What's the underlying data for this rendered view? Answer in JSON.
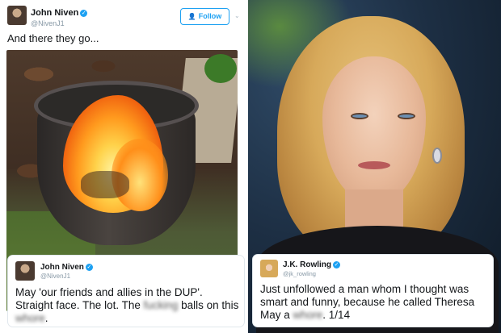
{
  "left_tweet": {
    "author_name": "John Niven",
    "author_handle": "@NivenJ1",
    "follow_label": "Follow",
    "text": "And there they go..."
  },
  "quoted_tweet": {
    "author_name": "John Niven",
    "author_handle": "@NivenJ1",
    "text_before": "May 'our friends and allies in the DUP'. Straight face. The lot. The ",
    "blurred_word_1": "fucking",
    "text_middle": " balls on this ",
    "blurred_word_2": "whore",
    "text_after": "."
  },
  "right_tweet": {
    "author_name": "J.K. Rowling",
    "author_handle": "@jk_rowling",
    "text_before": "Just unfollowed a man whom I thought was smart and funny, because he called Theresa May a ",
    "blurred_word": "whore",
    "text_after": ".  1/14"
  },
  "colors": {
    "twitter_blue": "#1da1f2",
    "text_dark": "#14171a",
    "text_muted": "#8899a6"
  },
  "icons": {
    "verified": "verified-check-icon",
    "follow": "add-user-icon",
    "menu": "chevron-down-icon"
  }
}
